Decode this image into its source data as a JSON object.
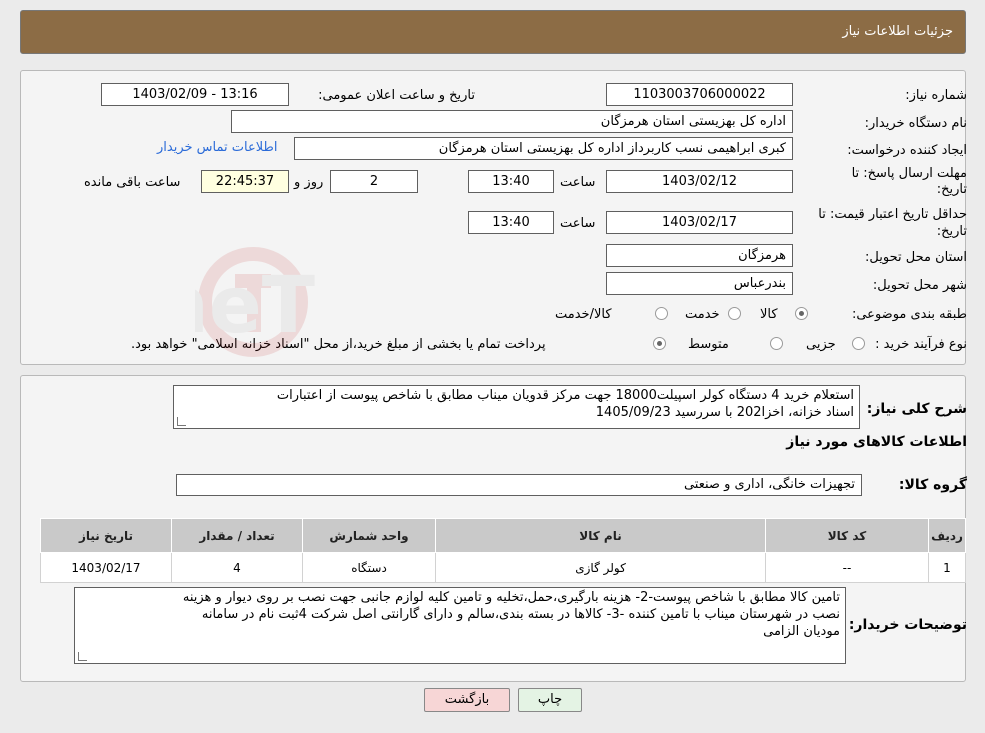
{
  "header": {
    "title": "جزئیات اطلاعات نیاز"
  },
  "form": {
    "need_number_label": "شماره نیاز:",
    "need_number": "1103003706000022",
    "announce_label": "تاریخ و ساعت اعلان عمومی:",
    "announce_value": "1403/02/09 - 13:16",
    "buyer_org_label": "نام دستگاه خریدار:",
    "buyer_org": "اداره کل بهزیستی استان هرمزگان",
    "creator_label": "ایجاد کننده درخواست:",
    "creator": "کبری  ابراهیمی نسب کاربرداز اداره کل بهزیستی استان هرمزگان",
    "contact_link": "اطلاعات تماس خریدار",
    "deadline_label_1": "مهلت ارسال پاسخ: تا",
    "deadline_label_2": "تاریخ:",
    "deadline_date": "1403/02/12",
    "time_label": "ساعت",
    "deadline_time": "13:40",
    "days_value": "2",
    "days_label": "روز و",
    "remaining_time": "22:45:37",
    "remaining_label": "ساعت باقی مانده",
    "validity_label_1": "حداقل تاریخ اعتبار قیمت: تا",
    "validity_label_2": "تاریخ:",
    "validity_date": "1403/02/17",
    "validity_time": "13:40",
    "province_label": "استان محل تحویل:",
    "province": "هرمزگان",
    "city_label": "شهر محل تحویل:",
    "city": "بندرعباس",
    "category_label": "طبقه بندی موضوعی:",
    "category_options": [
      "کالا",
      "خدمت",
      "کالا/خدمت"
    ],
    "process_label": "نوع فرآیند خرید :",
    "process_options": [
      "جزیی",
      "متوسط"
    ],
    "process_note": "پرداخت تمام یا بخشی از مبلغ خرید،از محل \"اسناد خزانه اسلامی\" خواهد بود."
  },
  "details": {
    "summary_label": "شرح کلی نیاز:",
    "summary_line1": "استعلام خرید 4 دستگاه کولر اسپیلت18000 جهت مرکز قدویان میناب مطابق با شاخص پیوست از اعتبارات",
    "summary_line2": "اسناد خزانه، اخزا202 با سررسید  1405/09/23",
    "goods_info_title": "اطلاعات کالاهای مورد نیاز",
    "group_label": "گروه کالا:",
    "group_value": "تجهیزات خانگی، اداری و صنعتی",
    "table_headers": [
      "ردیف",
      "کد کالا",
      "نام کالا",
      "واحد شمارش",
      "تعداد / مقدار",
      "تاریخ نیاز"
    ],
    "table_rows": [
      [
        "1",
        "--",
        "کولر گازی",
        "دستگاه",
        "4",
        "1403/02/17"
      ]
    ],
    "buyer_notes_label": "توضیحات خریدار:",
    "buyer_notes_line1": "تامین کالا مطابق با شاخص پیوست-2- هزینه بارگیری،حمل،تخلیه و تامین کلیه  لوازم جانبی جهت نصب بر روی دیوار و هزینه",
    "buyer_notes_line2": "نصب در شهرستان میناب  با تامین کننده -3- کالاها در بسته بندی،سالم و دارای گارانتی اصل شرکت 4ثبت نام در سامانه",
    "buyer_notes_line3": "مودیان الزامی"
  },
  "buttons": {
    "print": "چاپ",
    "back": "بازگشت"
  },
  "watermark": {
    "text": "AriaTender.neT"
  },
  "colors": {
    "header": "#8c6c45",
    "back_button": "#f7d6d6",
    "print_button": "#e4f3e4"
  }
}
